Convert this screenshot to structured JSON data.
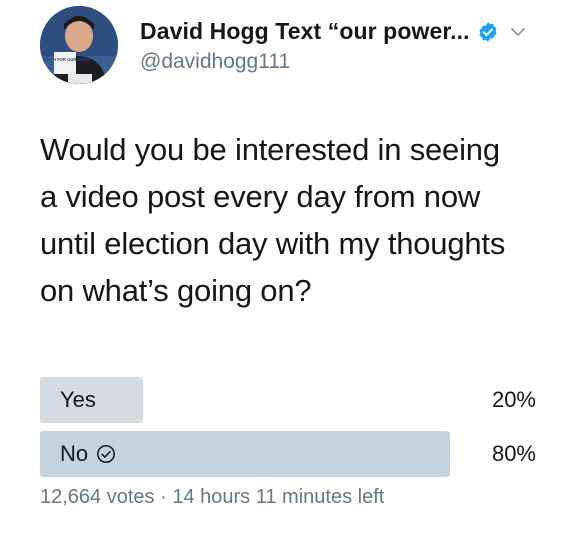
{
  "user": {
    "display_name": "David Hogg Text “our power...",
    "handle": "@davidhogg111",
    "verified_icon": "verified-badge-icon",
    "menu_icon": "chevron-down-icon",
    "avatar_sign_text": "MARCH FOR OUR LIVES",
    "brand_color": "#1da1f2"
  },
  "tweet": {
    "lines": [
      "Would you be interested in seeing",
      "a video post every day from now",
      "until election day with my thoughts",
      "on what’s going on?"
    ]
  },
  "poll": {
    "options": [
      {
        "label": "Yes",
        "percent_label": "20%",
        "percent": 20,
        "selected": false
      },
      {
        "label": "No",
        "percent_label": "80%",
        "percent": 80,
        "selected": true
      }
    ],
    "votes": "12,664 votes",
    "separator": "·",
    "time_left": "14 hours 11 minutes left",
    "bar_color": "#d3dbe3"
  }
}
